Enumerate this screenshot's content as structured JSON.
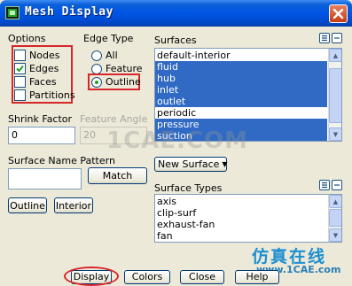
{
  "window": {
    "title": "Mesh Display"
  },
  "options": {
    "title": "Options",
    "items": [
      {
        "label": "Nodes",
        "checked": false
      },
      {
        "label": "Edges",
        "checked": true
      },
      {
        "label": "Faces",
        "checked": false
      },
      {
        "label": "Partitions",
        "checked": false
      }
    ]
  },
  "edge_type": {
    "title": "Edge Type",
    "items": [
      {
        "label": "All",
        "selected": false
      },
      {
        "label": "Feature",
        "selected": false
      },
      {
        "label": "Outline",
        "selected": true
      }
    ]
  },
  "surfaces": {
    "title": "Surfaces",
    "items": [
      {
        "label": "default-interior",
        "selected": false
      },
      {
        "label": "fluid",
        "selected": true
      },
      {
        "label": "hub",
        "selected": true
      },
      {
        "label": "inlet",
        "selected": true
      },
      {
        "label": "outlet",
        "selected": true
      },
      {
        "label": "periodic",
        "selected": false
      },
      {
        "label": "pressure",
        "selected": true
      },
      {
        "label": "suction",
        "selected": true
      }
    ],
    "new_surface_label": "New Surface"
  },
  "shrink_factor": {
    "label": "Shrink Factor",
    "value": "0"
  },
  "feature_angle": {
    "label": "Feature Angle",
    "value": "20"
  },
  "surface_name_pattern": {
    "label": "Surface Name Pattern",
    "value": "",
    "match_label": "Match"
  },
  "outline_button": "Outline",
  "interior_button": "Interior",
  "surface_types": {
    "title": "Surface Types",
    "items": [
      "axis",
      "clip-surf",
      "exhaust-fan",
      "fan"
    ]
  },
  "bottom_buttons": [
    "Display",
    "Colors",
    "Close",
    "Help"
  ],
  "watermark": {
    "center": "1CAE.COM",
    "brand_cn": "仿真在线",
    "brand_url": "www.1CAE.com"
  },
  "colors": {
    "selection": "#316ac5",
    "annotation": "#d8262a",
    "titlebar": "#0055e5"
  }
}
